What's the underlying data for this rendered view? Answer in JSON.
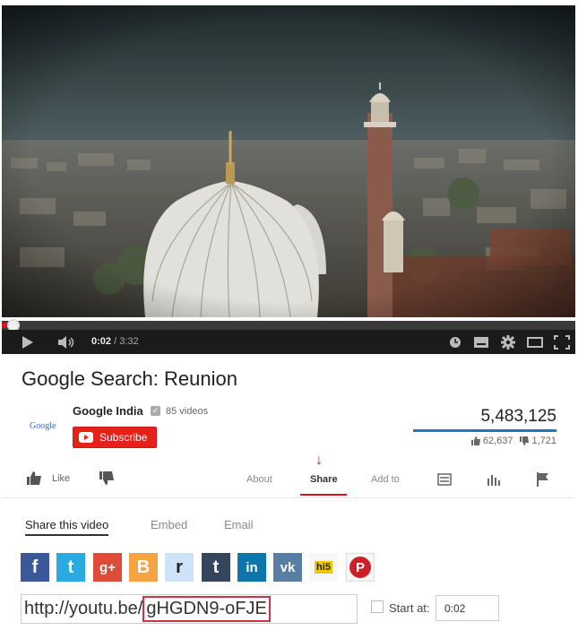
{
  "player": {
    "current_time": "0:02",
    "separator": "/",
    "duration": "3:32",
    "progress_fraction": 0.01
  },
  "video": {
    "title": "Google Search: Reunion"
  },
  "channel": {
    "logo_text": "Google",
    "name": "Google India",
    "video_count": "85 videos",
    "subscribe_label": "Subscribe"
  },
  "stats": {
    "views": "5,483,125",
    "likes": "62,637",
    "dislikes": "1,721",
    "like_fraction": 0.973
  },
  "actions": {
    "like_label": "Like",
    "tabs": [
      "About",
      "Share",
      "Add to"
    ],
    "active_tab": "Share"
  },
  "share": {
    "tabs": [
      "Share this video",
      "Embed",
      "Email"
    ],
    "networks": [
      {
        "name": "facebook",
        "glyph": "f",
        "color": "#3b5998"
      },
      {
        "name": "twitter",
        "glyph": "t",
        "color": "#2ba9e1"
      },
      {
        "name": "google-plus",
        "glyph": "g+",
        "color": "#dd4b39"
      },
      {
        "name": "blogger",
        "glyph": "B",
        "color": "#f4a442"
      },
      {
        "name": "reddit",
        "glyph": "r",
        "color": "#cee3f8"
      },
      {
        "name": "tumblr",
        "glyph": "t",
        "color": "#35465c"
      },
      {
        "name": "linkedin",
        "glyph": "in",
        "color": "#0e76a8"
      },
      {
        "name": "vk",
        "glyph": "vk",
        "color": "#587ea3"
      },
      {
        "name": "hi5",
        "glyph": "hi5",
        "color": "#f7f7f7"
      },
      {
        "name": "pinterest",
        "glyph": "P",
        "color": "#cb2027"
      }
    ],
    "url_prefix": "http://youtu.be/",
    "url_id": "gHGDN9-oFJE",
    "start_label": "Start at:",
    "start_value": "0:02"
  }
}
